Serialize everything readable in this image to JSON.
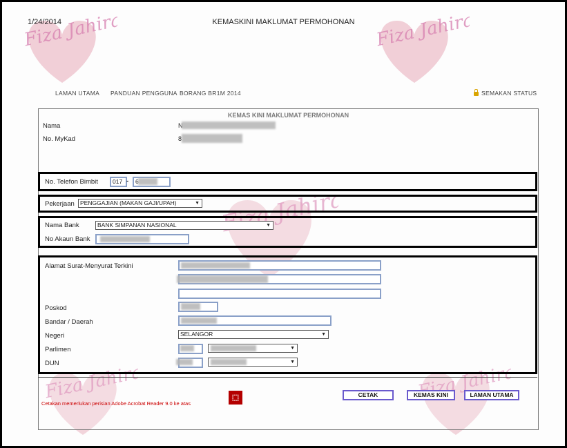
{
  "header": {
    "date": "1/24/2014",
    "title": "KEMASKINI MAKLUMAT PERMOHONAN"
  },
  "watermark": {
    "text": "Fiza Jahirah",
    "color": "#d77fb0",
    "heart_color": "#d9788e"
  },
  "nav": {
    "items": [
      "LAMAN UTAMA",
      "PANDUAN PENGGUNA",
      "BORANG BR1M 2014"
    ],
    "status": "SEMAKAN STATUS"
  },
  "form": {
    "title": "KEMAS KINI MAKLUMAT PERMOHONAN",
    "nama_label": "Nama",
    "nama_value": "N",
    "mykad_label": "No. MyKad",
    "mykad_value": "8",
    "phone_label": "No. Telefon Bimbit",
    "phone_prefix": "017",
    "phone_separator": "-",
    "phone_number": "6",
    "pekerjaan_label": "Pekerjaan",
    "pekerjaan_value": "PENGGAJIAN (MAKAN GAJI/UPAH)",
    "bank_label": "Nama Bank",
    "bank_value": "BANK SIMPANAN NASIONAL",
    "akaun_label": "No Akaun Bank",
    "alamat_label": "Alamat Surat-Menyurat Terkini",
    "poskod_label": "Poskod",
    "bandar_label": "Bandar / Daerah",
    "negeri_label": "Negeri",
    "negeri_value": "SELANGOR",
    "parlimen_label": "Parlimen",
    "dun_label": "DUN"
  },
  "footer": {
    "note": "Cetakan memerlukan perisian Adobe Acrobat Reader 9.0 ke atas",
    "pdf_icon": "pdf-icon",
    "cetak": "CETAK",
    "kemas_kini": "KEMAS KINI",
    "laman_utama": "LAMAN UTAMA"
  }
}
